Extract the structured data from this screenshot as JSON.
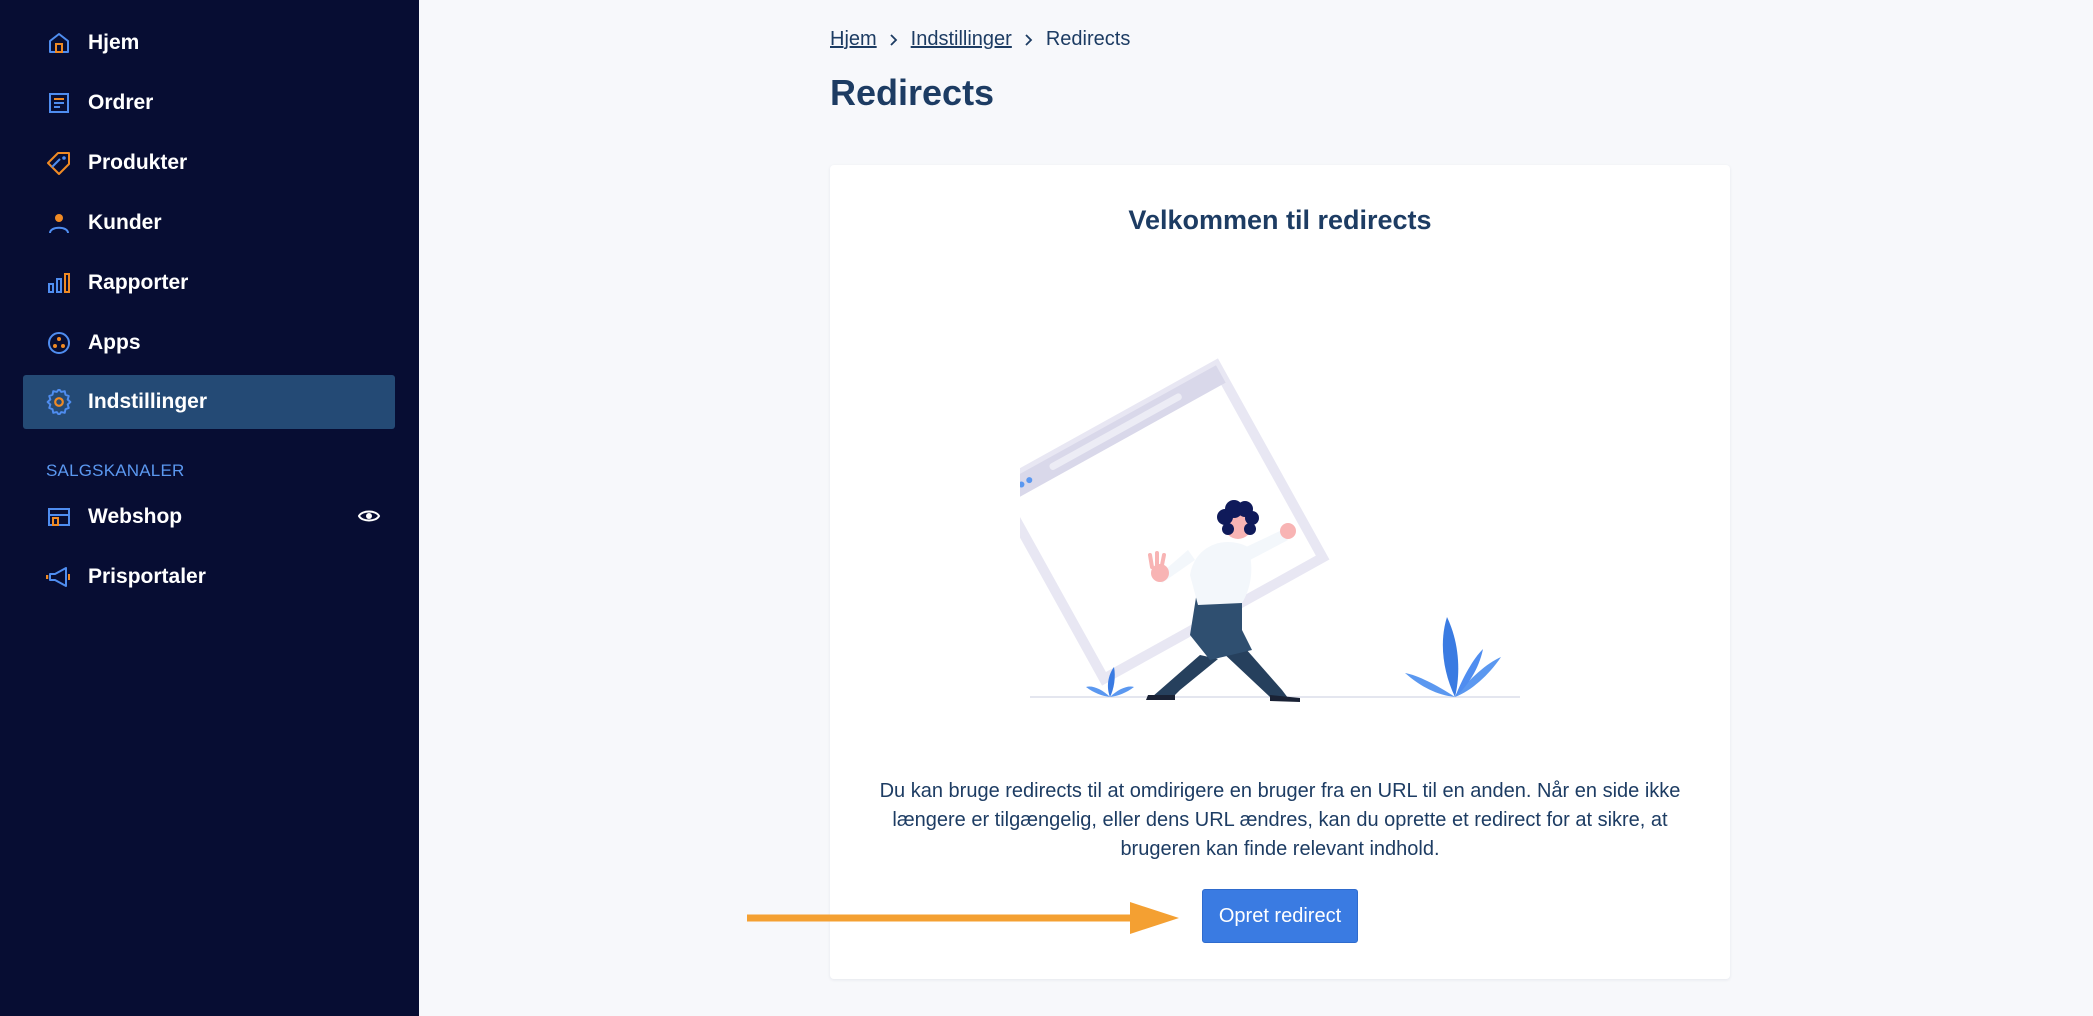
{
  "sidebar": {
    "items": [
      {
        "label": "Hjem",
        "icon": "home-icon"
      },
      {
        "label": "Ordrer",
        "icon": "orders-icon"
      },
      {
        "label": "Produkter",
        "icon": "tag-icon"
      },
      {
        "label": "Kunder",
        "icon": "user-icon"
      },
      {
        "label": "Rapporter",
        "icon": "bar-chart-icon"
      },
      {
        "label": "Apps",
        "icon": "apps-icon"
      },
      {
        "label": "Indstillinger",
        "icon": "gear-icon",
        "active": true
      }
    ],
    "section_label": "SALGSKANALER",
    "channels": [
      {
        "label": "Webshop",
        "icon": "store-icon"
      },
      {
        "label": "Prisportaler",
        "icon": "megaphone-icon"
      }
    ]
  },
  "breadcrumb": {
    "items": [
      "Hjem",
      "Indstillinger"
    ],
    "current": "Redirects"
  },
  "page": {
    "title": "Redirects"
  },
  "card": {
    "title": "Velkommen til redirects",
    "description": "Du kan bruge redirects til at omdirigere en bruger fra en URL til en anden. Når en side ikke længere er tilgængelig, eller dens URL ændres, kan du oprette et redirect for at sikre, at brugeren kan finde relevant indhold.",
    "button_label": "Opret redirect"
  },
  "colors": {
    "sidebar_bg": "#070d33",
    "active_bg": "#244a75",
    "accent_blue": "#3a7be2",
    "accent_orange": "#f08a24",
    "text_dark": "#1d3c63",
    "arrow": "#f4a032"
  }
}
